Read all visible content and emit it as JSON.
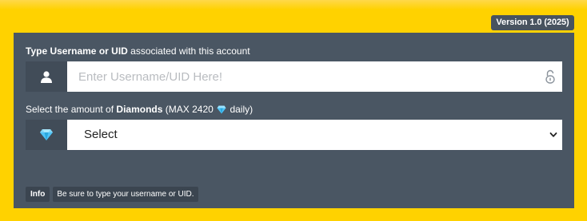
{
  "header": {
    "version_badge": "Version 1.0 (2025)"
  },
  "form": {
    "username": {
      "label_bold": "Type Username or UID",
      "label_rest": " associated with this account",
      "placeholder": "Enter Username/UID Here!",
      "value": "",
      "icon": "user-icon",
      "trailing_icon": "lock-icon"
    },
    "diamonds": {
      "label_start": "Select the amount of ",
      "label_bold": "Diamonds",
      "label_max": " (MAX 2420 ",
      "label_end": " daily)",
      "selected": "Select",
      "icon": "diamond-icon"
    },
    "info": {
      "tag": "Info",
      "text": "Be sure to type your username or UID."
    }
  },
  "colors": {
    "background": "#ffd200",
    "panel": "#4a5663",
    "addon": "#414c58",
    "diamond": "#4fc3f7"
  }
}
